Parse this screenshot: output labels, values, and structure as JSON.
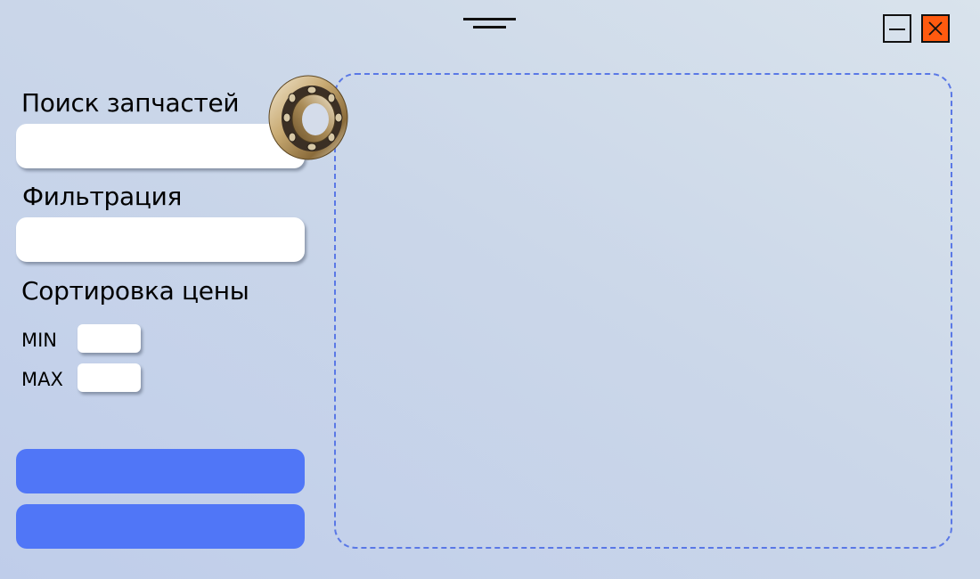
{
  "titlebar": {
    "drag_icon": "drag-handle-icon",
    "minimize_icon": "minimize-icon",
    "close_icon": "close-icon",
    "close_color": "#ff5a0f"
  },
  "sidebar": {
    "search_label": "Поиск запчастей",
    "search_value": "",
    "filter_label": "Фильтрация",
    "filter_value": "",
    "sort_label": "Сортировка цены",
    "min_label": "MIN",
    "min_value": "",
    "max_label": "MAX",
    "max_value": "",
    "button_1_label": "",
    "button_2_label": "",
    "button_color": "#5076f7"
  },
  "logo": {
    "icon": "ball-bearing-icon"
  },
  "results_panel": {
    "items": [],
    "border_color": "#5a78e6"
  }
}
